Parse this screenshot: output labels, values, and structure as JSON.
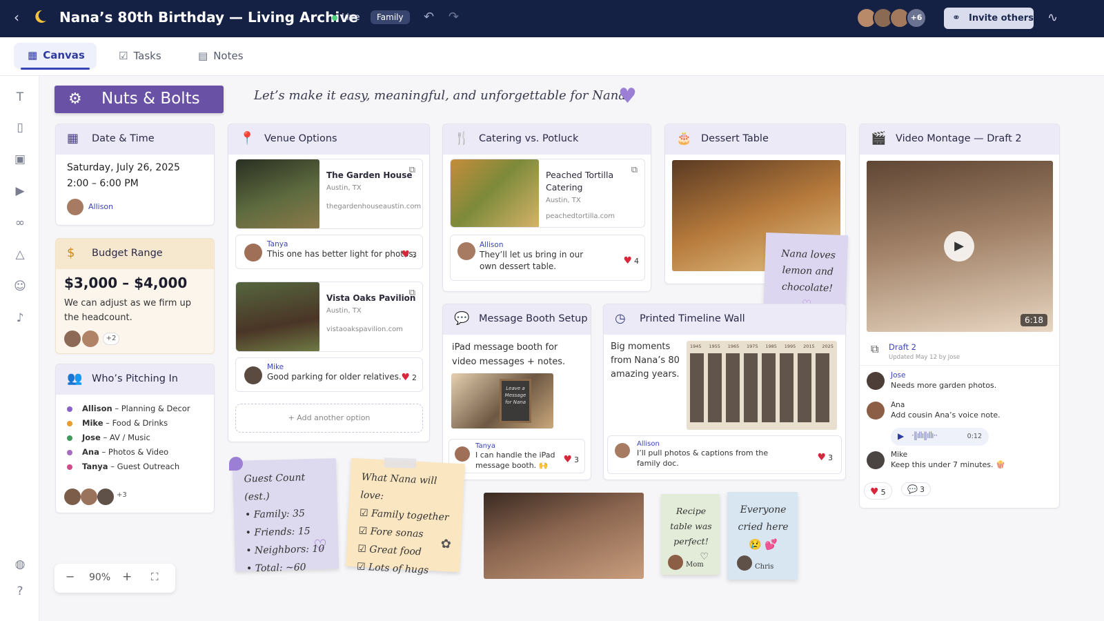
{
  "topbar": {
    "title": "Nana’s 80th Birthday — Living Archive",
    "live": "Live",
    "family_badge": "Family",
    "avatars_more": "+6",
    "invite_label": "Invite others"
  },
  "tabs": [
    {
      "label": "Canvas"
    },
    {
      "label": "Tasks"
    },
    {
      "label": "Notes"
    }
  ],
  "header": {
    "chip": "Nuts & Bolts",
    "tagline": "Let’s make it easy, meaningful, and unforgettable for Nana."
  },
  "date_time": {
    "title": "Date & Time",
    "date": "Saturday, July 26, 2025",
    "time": "2:00 – 6:00 PM",
    "owner": "Allison"
  },
  "budget": {
    "title": "Budget Range",
    "range": "$3,000 – $4,000",
    "note": "We can adjust as we firm up the headcount.",
    "more": "+2"
  },
  "pitching": {
    "title": "Who’s Pitching In",
    "members": [
      {
        "name": "Allison",
        "role": " – Planning & Decor",
        "color": "#8a62cc"
      },
      {
        "name": "Mike",
        "role": " – Food & Drinks",
        "color": "#e89b2e"
      },
      {
        "name": "Jose",
        "role": " – AV / Music",
        "color": "#3e9b5a"
      },
      {
        "name": "Ana",
        "role": " – Photos & Video",
        "color": "#a86bc4"
      },
      {
        "name": "Tanya",
        "role": " – Guest Outreach",
        "color": "#d24a8a"
      }
    ],
    "more": "+3"
  },
  "venue": {
    "title": "Venue Options",
    "options": [
      {
        "name": "The Garden House",
        "city": "Austin, TX",
        "url": "thegardenhouseaustin.com",
        "commenter": "Tanya",
        "comment": "This one has better light for photos.",
        "likes": "3"
      },
      {
        "name": "Vista Oaks Pavilion",
        "city": "Austin, TX",
        "url": "vistaoakspavilion.com",
        "commenter": "Mike",
        "comment": "Good parking for older relatives.",
        "likes": "2"
      }
    ],
    "add_label": "+ Add another option"
  },
  "catering": {
    "title": "Catering vs. Potluck",
    "name": "Peached Tortilla Catering",
    "city": "Austin, TX",
    "url": "peachedtortilla.com",
    "commenter": "Allison",
    "comment": "They’ll let us bring in our own dessert table.",
    "likes": "4"
  },
  "dessert": {
    "title": "Dessert Table",
    "sticky": "Nana loves lemon and chocolate!"
  },
  "message_booth": {
    "title": "Message Booth Setup",
    "desc": "iPad message booth for video messages + notes.",
    "chalk": "Leave a Message for Nana",
    "commenter": "Tanya",
    "comment": "I can handle the iPad message booth. 🙌",
    "likes": "3"
  },
  "timeline": {
    "title": "Printed Timeline Wall",
    "desc": "Big moments from Nana’s 80 amazing years.",
    "years": [
      "1945",
      "1955",
      "1965",
      "1975",
      "1985",
      "1995",
      "2015",
      "2025"
    ],
    "commenter": "Allison",
    "comment": "I’ll pull photos & captions from the family doc.",
    "likes": "3"
  },
  "video": {
    "title": "Video Montage — Draft 2",
    "duration": "6:18",
    "draft": "Draft 2",
    "updated": "Updated May 12 by Jose",
    "comments": [
      {
        "name": "Jose",
        "text": "Needs more garden photos."
      },
      {
        "name": "Ana",
        "text": "Add cousin Ana’s voice note."
      },
      {
        "name": "Mike",
        "text": "Keep this under 7 minutes. 🍿"
      }
    ],
    "voice_duration": "0:12",
    "likes": "5",
    "comment_count": "3"
  },
  "stickies": {
    "guest": {
      "title": "Guest Count (est.)",
      "lines": [
        "• Family: 35",
        "• Friends: 15",
        "• Neighbors: 10",
        "• Total: ~60"
      ]
    },
    "love": {
      "title": "What Nana will love:",
      "items": [
        "Family together",
        "Fore sonas",
        "Great food",
        "Lots of hugs"
      ]
    },
    "recipe": {
      "text": "Recipe table was perfect!",
      "author": "Mom"
    },
    "cried": {
      "text": "Everyone cried here",
      "emoji": "😢 💕",
      "author": "Chris"
    }
  },
  "zoom": {
    "level": "90%"
  }
}
